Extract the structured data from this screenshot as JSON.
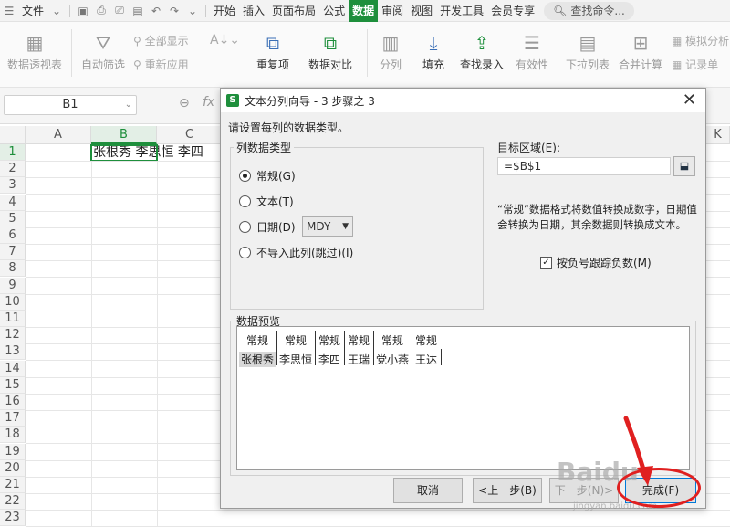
{
  "menubar": {
    "file_label": "文件",
    "tabs": [
      "开始",
      "插入",
      "页面布局",
      "公式",
      "数据",
      "审阅",
      "视图",
      "开发工具",
      "会员专享"
    ],
    "active_tab": "数据",
    "search_label": "查找命令..."
  },
  "ribbon": {
    "pivot": "数据透视表",
    "autofilter": "自动筛选",
    "show_all": "全部显示",
    "reapply": "重新应用",
    "duplicates": "重复项",
    "compare": "数据对比",
    "split": "分列",
    "fill": "填充",
    "find_entry": "查找录入",
    "validity": "有效性",
    "dropdown": "下拉列表",
    "consolidate": "合并计算",
    "simulate": "模拟分析",
    "record": "记录单"
  },
  "formula_bar": {
    "name_box": "B1",
    "fx": "fx"
  },
  "sheet": {
    "columns": [
      "A",
      "B",
      "C"
    ],
    "selected_column": "B",
    "rows": [
      "1",
      "2",
      "3",
      "4",
      "5",
      "6",
      "7",
      "8",
      "9",
      "10",
      "11",
      "12",
      "13",
      "14",
      "15",
      "16",
      "17",
      "18",
      "19",
      "20",
      "21",
      "22",
      "23"
    ],
    "cell_b1": "张根秀 李思恒 李四",
    "right_col": "K"
  },
  "dialog": {
    "title": "文本分列向导 - 3 步骤之 3",
    "instruction": "请设置每列的数据类型。",
    "group_title": "列数据类型",
    "options": {
      "general": "常规(G)",
      "text": "文本(T)",
      "date": "日期(D)",
      "skip": "不导入此列(跳过)(I)"
    },
    "selected_option": "general",
    "date_format": "MDY",
    "target_label": "目标区域(E):",
    "target_value": "=$B$1",
    "description": "“常规”数据格式将数值转换成数字，日期值会转换为日期，其余数据则转换成文本。",
    "checkbox_label": "按负号跟踪负数(M)",
    "checkbox_checked": true,
    "preview_title": "数据预览",
    "preview_headers": [
      "常规",
      "常规",
      "常规",
      "常规",
      "常规",
      "常规"
    ],
    "preview_values": [
      "张根秀",
      "李思恒",
      "李四",
      "王瑞",
      "党小燕",
      "王达"
    ],
    "buttons": {
      "cancel": "取消",
      "back": "<上一步(B)",
      "next": "下一步(N)>",
      "finish": "完成(F)"
    }
  },
  "watermark": {
    "text": "Baidu",
    "sub": "jingyan.baidu.com"
  },
  "colors": {
    "accent": "#1e8f3c",
    "annotation": "#e02020"
  }
}
